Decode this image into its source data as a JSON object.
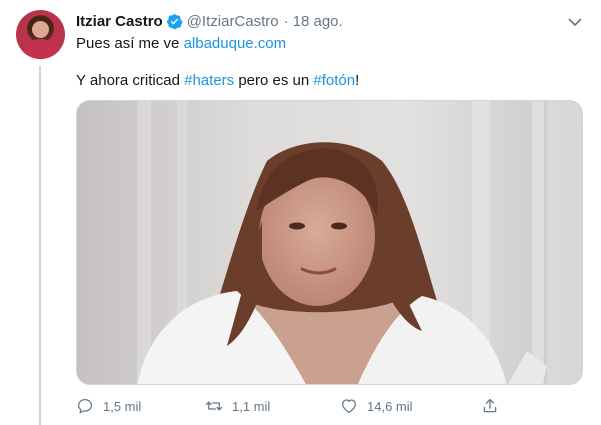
{
  "tweet": {
    "author": {
      "display_name": "Itziar Castro",
      "handle": "@ItziarCastro",
      "verified_icon": "verified-badge-icon",
      "avatar": "avatar-photo"
    },
    "separator": "·",
    "timestamp": "18 ago.",
    "text_line1": {
      "prefix": "Pues así me ve ",
      "link": "albaduque.com"
    },
    "text_line2": {
      "part1": "Y ahora criticad ",
      "hashtag1": "#haters",
      "part2": " pero es un ",
      "hashtag2": "#fotón",
      "part3": "!"
    },
    "media": {
      "description_icon": "photo-image"
    },
    "actions": {
      "reply_count": "1,5 mil",
      "retweet_count": "1,1 mil",
      "like_count": "14,6 mil"
    }
  },
  "colors": {
    "link": "#1b95e0",
    "secondary_text": "#657786",
    "verified": "#1da1f2",
    "border": "#ccd6dd"
  }
}
